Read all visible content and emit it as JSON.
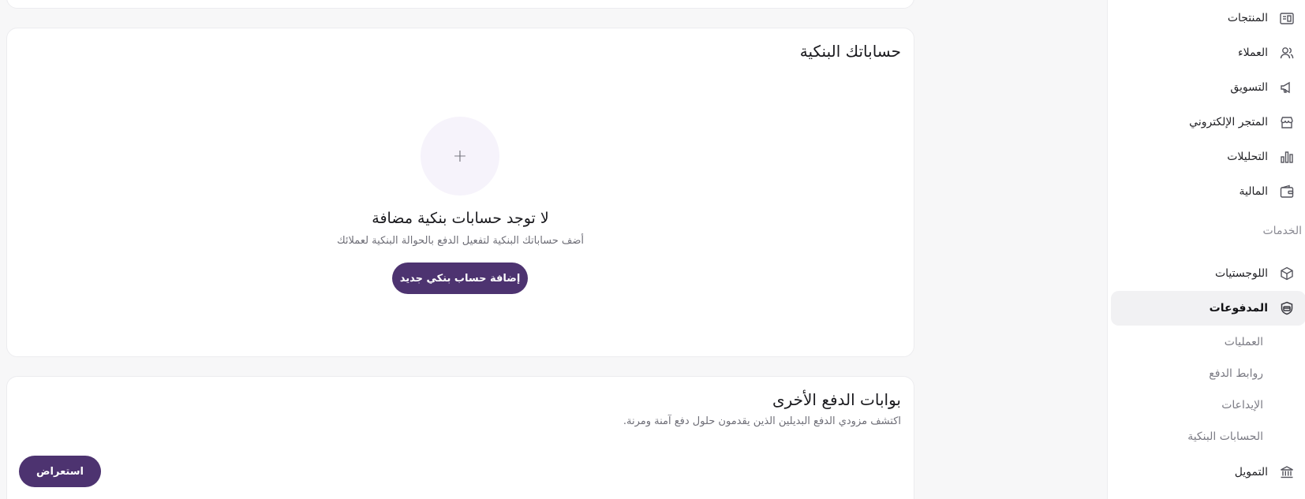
{
  "sidebar": {
    "items": [
      {
        "label": "المنتجات",
        "icon": "products-icon"
      },
      {
        "label": "العملاء",
        "icon": "customers-icon"
      },
      {
        "label": "التسويق",
        "icon": "megaphone-icon"
      },
      {
        "label": "المتجر الإلكتروني",
        "icon": "store-icon"
      },
      {
        "label": "التحليلات",
        "icon": "bar-chart-icon"
      },
      {
        "label": "المالية",
        "icon": "wallet-icon"
      }
    ],
    "services_label": "الخدمات",
    "services": [
      {
        "label": "اللوجستيات",
        "icon": "box-icon"
      },
      {
        "label": "المدفوعات",
        "icon": "payments-icon",
        "active": true
      }
    ],
    "payments_subitems": [
      "العمليات",
      "روابط الدفع",
      "الإيداعات",
      "الحسابات البنكية"
    ],
    "financing": {
      "label": "التمويل",
      "icon": "bank-icon"
    }
  },
  "bank_accounts": {
    "title": "حساباتك البنكية",
    "plus_symbol": "+",
    "empty_title": "لا توجد حسابات بنكية مضافة",
    "empty_description": "أضف حساباتك البنكية لتفعيل الدفع بالحوالة البنكية لعملائك",
    "add_button_label": "إضافة حساب بنكي جديد"
  },
  "other_gateways": {
    "title": "بوابات الدفع الأخرى",
    "description": "اكتشف مزودي الدفع البديلين الذين يقدمون حلول دفع آمنة ومرنة.",
    "browse_button_label": "استعراض"
  },
  "colors": {
    "primary": "#4d3370",
    "active_nav_bg": "#f1f1f3",
    "plus_circle_bg": "#f6f3fb"
  }
}
